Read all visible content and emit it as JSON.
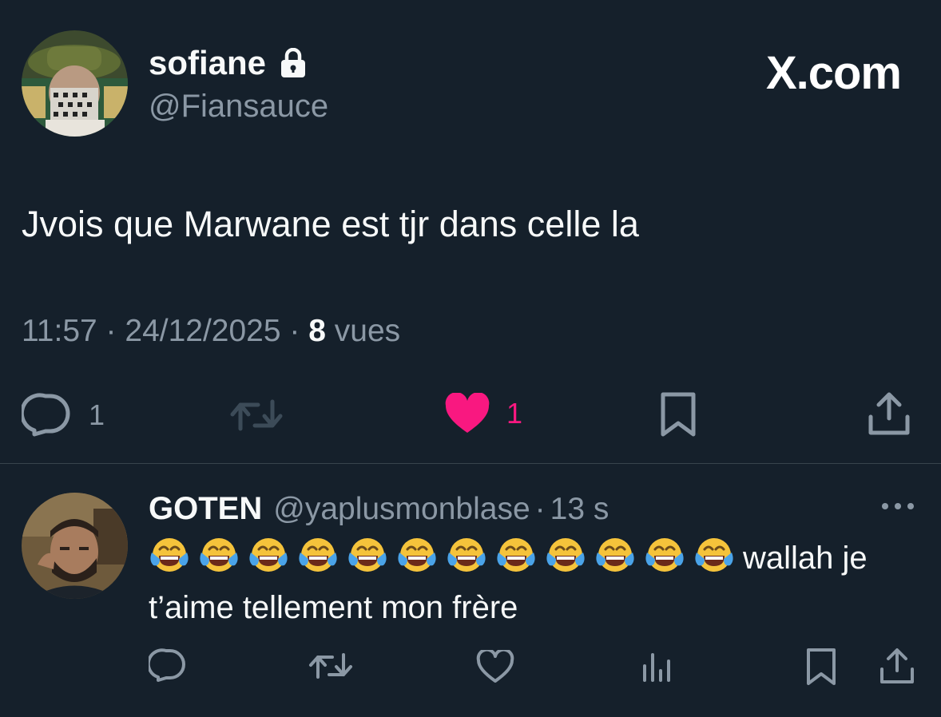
{
  "brand": {
    "label": "X.com"
  },
  "tweet": {
    "author_name": "sofiane",
    "author_handle": "@Fiansauce",
    "protected_icon": "lock-icon",
    "text": "Jvois que Marwane est tjr dans celle la",
    "time": "11:57",
    "date": "24/12/2025",
    "views_count": "8",
    "views_label": "vues",
    "actions": {
      "reply": {
        "icon": "reply-icon",
        "count": "1"
      },
      "retweet": {
        "icon": "retweet-icon"
      },
      "like": {
        "icon": "heart-filled-icon",
        "count": "1",
        "color": "#f91880"
      },
      "bookmark": {
        "icon": "bookmark-icon"
      },
      "share": {
        "icon": "share-icon"
      }
    }
  },
  "reply": {
    "author_name": "GOTEN",
    "author_handle": "@yaplusmonblase",
    "time": "13 s",
    "emoji": "😂",
    "emoji_count": 12,
    "text": "wallah je t’aime tellement mon frère",
    "actions": [
      "reply-icon",
      "retweet-icon",
      "heart-outline-icon",
      "views-chart-icon",
      "bookmark-icon",
      "share-icon"
    ]
  },
  "colors": {
    "background": "#15202b",
    "text_primary": "#f7f9f9",
    "text_secondary": "#8b98a5",
    "like": "#f91880",
    "divider": "#38444d"
  }
}
